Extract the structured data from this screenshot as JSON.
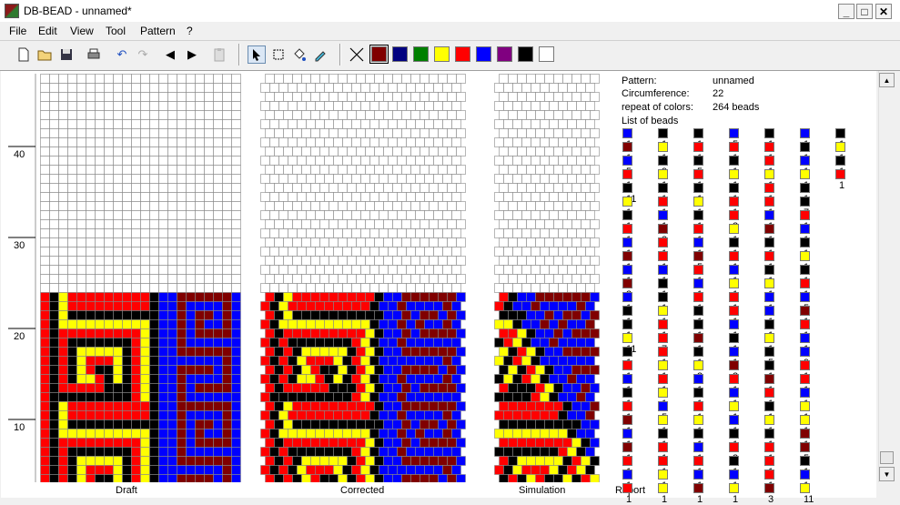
{
  "window": {
    "title": "DB-BEAD - unnamed*",
    "minimize": "_",
    "maximize": "□",
    "close": "✕"
  },
  "menu": [
    "File",
    "Edit",
    "View",
    "Tool",
    "Pattern",
    "?"
  ],
  "toolbar": {
    "icons": [
      "new-icon",
      "open-icon",
      "save-icon",
      "print-icon",
      "undo-icon",
      "redo-icon",
      "arrow-left-icon",
      "arrow-right-icon",
      "paste-icon",
      "pointer-icon",
      "select-rect-icon",
      "fill-icon",
      "pipette-icon",
      "erase-icon"
    ]
  },
  "palette": [
    "#800000",
    "#000080",
    "#008000",
    "#ffff00",
    "#ff0000",
    "#0000ff",
    "#800080",
    "#000000",
    "#ffffff"
  ],
  "ruler": [
    "40",
    "30",
    "20",
    "10"
  ],
  "views": {
    "draft": "Draft",
    "corrected": "Corrected",
    "simulation": "Simulation",
    "report": "Report"
  },
  "pattern": {
    "rows": 48,
    "cols": 22,
    "filled_rows": 24,
    "key": {
      "w": "#ffffff",
      "k": "#000000",
      "y": "#ffff00",
      "r": "#ff0000",
      "m": "#800000",
      "b": "#0000ff"
    },
    "draft": [
      "rkyrrrrrrrrrkbbmmmmmmb",
      "rkyrrrrrrrrrkbbmbbbbmb",
      "rkykkkkkkkkkkbbmbmmbmb",
      "rkyyyyyyyyyykbbmbmbbmb",
      "rkrrrrrrrrrykbbmbmmmmb",
      "rkrkkkkkkkrykbbmbbbbbb",
      "rkrkyyyyykrykbbmmmmmmb",
      "rkrkyrrrykrykbbbbbbbmb",
      "rkrkyrkkykrykbbmmmmbmb",
      "rkrkyyrkykrykbbmbbbbmb",
      "rkrrrrrkkkrykbbmbmmmmb",
      "rkkkkkkkkkrykbbmbbbbbb",
      "rkyrrrrrrrrrkbbmmmmmmb",
      "rkyrrrrrrrrrkbbmbbbbmb",
      "rkykkkkkkkkkkbbmbmmbmb",
      "rkyyyyyyyyyykbbmbmbbmb",
      "rkrrrrrrrrrykbbmbmmmmb",
      "rkrkkkkkkkrykbbmbbbbbb",
      "rkrkyyyyykrykbbmmmmmmb",
      "rkrkyrrrykrykbbbbbbbmb",
      "rkrkyrkkykrykbbmmmmbmb",
      "rkrkyyrkykrykbbmbbbbmb",
      "rkrrrrrkkkrykbbmbmmmmb",
      "rkkkkkkkkkrykbbmbbbbbb"
    ]
  },
  "report": {
    "pattern_label": "Pattern:",
    "pattern_value": "unnamed",
    "circ_label": "Circumference:",
    "circ_value": "22",
    "repeat_label": "repeat of colors:",
    "repeat_value": "264 beads",
    "list_label": "List of beads",
    "columns": [
      [
        [
          "b",
          "1"
        ],
        [
          "m",
          "1"
        ],
        [
          "b",
          "5"
        ],
        [
          "r",
          "1"
        ],
        [
          "k",
          "11"
        ],
        [
          "y",
          "1"
        ],
        [
          "k",
          "1"
        ],
        [
          "r",
          "1"
        ],
        [
          "b",
          "1"
        ],
        [
          "m",
          "1"
        ],
        [
          "b",
          "1"
        ],
        [
          "m",
          "3"
        ],
        [
          "b",
          "1"
        ],
        [
          "k",
          "1"
        ],
        [
          "k",
          "1"
        ],
        [
          "y",
          "11"
        ],
        [
          "k",
          "1"
        ],
        [
          "r",
          "1"
        ],
        [
          "b",
          "1"
        ],
        [
          "k",
          "1"
        ],
        [
          "r",
          "1"
        ],
        [
          "m",
          "1"
        ],
        [
          "b",
          "1"
        ],
        [
          "m",
          "1"
        ],
        [
          "r",
          "1"
        ],
        [
          "b",
          "1"
        ],
        [
          "r",
          "1"
        ]
      ],
      [
        [
          "k",
          "1"
        ],
        [
          "y",
          "1"
        ],
        [
          "k",
          "9"
        ],
        [
          "y",
          "1"
        ],
        [
          "k",
          "1"
        ],
        [
          "r",
          "1"
        ],
        [
          "b",
          "1"
        ],
        [
          "m",
          "3"
        ],
        [
          "r",
          "1"
        ],
        [
          "r",
          "1"
        ],
        [
          "b",
          "1"
        ],
        [
          "k",
          "1"
        ],
        [
          "k",
          "1"
        ],
        [
          "y",
          "1"
        ],
        [
          "r",
          "1"
        ],
        [
          "r",
          "7"
        ],
        [
          "r",
          "1"
        ],
        [
          "y",
          "1"
        ],
        [
          "r",
          "1"
        ],
        [
          "y",
          "1"
        ],
        [
          "b",
          "5"
        ],
        [
          "y",
          "1"
        ],
        [
          "k",
          "1"
        ],
        [
          "r",
          "1"
        ],
        [
          "r",
          "1"
        ],
        [
          "y",
          "1"
        ],
        [
          "y",
          "1"
        ]
      ],
      [
        [
          "k",
          "1"
        ],
        [
          "r",
          "1"
        ],
        [
          "k",
          "5"
        ],
        [
          "r",
          "1"
        ],
        [
          "k",
          "1"
        ],
        [
          "y",
          "1"
        ],
        [
          "k",
          "1"
        ],
        [
          "r",
          "1"
        ],
        [
          "b",
          "1"
        ],
        [
          "m",
          "5"
        ],
        [
          "r",
          "1"
        ],
        [
          "b",
          "1"
        ],
        [
          "r",
          "1"
        ],
        [
          "k",
          "1"
        ],
        [
          "k",
          "1"
        ],
        [
          "m",
          "1"
        ],
        [
          "k",
          "1"
        ],
        [
          "y",
          "3"
        ],
        [
          "b",
          "1"
        ],
        [
          "k",
          "1"
        ],
        [
          "r",
          "1"
        ],
        [
          "y",
          "1"
        ],
        [
          "k",
          "1"
        ],
        [
          "b",
          "1"
        ],
        [
          "r",
          "1"
        ],
        [
          "b",
          "1"
        ],
        [
          "m",
          "1"
        ]
      ],
      [
        [
          "b",
          "5"
        ],
        [
          "r",
          "1"
        ],
        [
          "k",
          "1"
        ],
        [
          "y",
          "1"
        ],
        [
          "k",
          "1"
        ],
        [
          "r",
          "1"
        ],
        [
          "r",
          "3"
        ],
        [
          "y",
          "1"
        ],
        [
          "k",
          "1"
        ],
        [
          "r",
          "1"
        ],
        [
          "b",
          "1"
        ],
        [
          "y",
          "1"
        ],
        [
          "r",
          "1"
        ],
        [
          "r",
          "1"
        ],
        [
          "b",
          "1"
        ],
        [
          "k",
          "1"
        ],
        [
          "b",
          "1"
        ],
        [
          "m",
          "3"
        ],
        [
          "r",
          "1"
        ],
        [
          "b",
          "1"
        ],
        [
          "y",
          "1"
        ],
        [
          "b",
          "1"
        ],
        [
          "k",
          "1"
        ],
        [
          "r",
          "3"
        ],
        [
          "k",
          "1"
        ],
        [
          "b",
          "1"
        ],
        [
          "y",
          "1"
        ]
      ],
      [
        [
          "k",
          "1"
        ],
        [
          "r",
          "1"
        ],
        [
          "r",
          "1"
        ],
        [
          "y",
          "1"
        ],
        [
          "r",
          "1"
        ],
        [
          "r",
          "1"
        ],
        [
          "b",
          "1"
        ],
        [
          "m",
          "1"
        ],
        [
          "k",
          "1"
        ],
        [
          "r",
          "1"
        ],
        [
          "k",
          "1"
        ],
        [
          "y",
          "1"
        ],
        [
          "b",
          "1"
        ],
        [
          "b",
          "1"
        ],
        [
          "k",
          "1"
        ],
        [
          "y",
          "1"
        ],
        [
          "k",
          "5"
        ],
        [
          "k",
          "1"
        ],
        [
          "m",
          "1"
        ],
        [
          "r",
          "1"
        ],
        [
          "k",
          "1"
        ],
        [
          "y",
          "1"
        ],
        [
          "k",
          "1"
        ],
        [
          "r",
          "1"
        ],
        [
          "r",
          "1"
        ],
        [
          "r",
          "1"
        ],
        [
          "m",
          "3"
        ]
      ],
      [
        [
          "b",
          "1"
        ],
        [
          "k",
          "1"
        ],
        [
          "b",
          "1"
        ],
        [
          "y",
          "1"
        ],
        [
          "k",
          "1"
        ],
        [
          "k",
          "7"
        ],
        [
          "r",
          "1"
        ],
        [
          "b",
          "1"
        ],
        [
          "k",
          "1"
        ],
        [
          "y",
          "1"
        ],
        [
          "k",
          "1"
        ],
        [
          "r",
          "1"
        ],
        [
          "b",
          "5"
        ],
        [
          "m",
          "1"
        ],
        [
          "r",
          "1"
        ],
        [
          "b",
          "1"
        ],
        [
          "b",
          "9"
        ],
        [
          "r",
          "1"
        ],
        [
          "r",
          "1"
        ],
        [
          "b",
          "1"
        ],
        [
          "y",
          "1"
        ],
        [
          "y",
          "1"
        ],
        [
          "m",
          "1"
        ],
        [
          "m",
          "5"
        ],
        [
          "k",
          "1"
        ],
        [
          "b",
          "1"
        ],
        [
          "y",
          "11"
        ]
      ],
      [
        [
          "k",
          "1"
        ],
        [
          "y",
          "1"
        ],
        [
          "k",
          "1"
        ],
        [
          "r",
          "1"
        ]
      ]
    ]
  },
  "scroll": {
    "up": "▲",
    "down": "▼"
  }
}
